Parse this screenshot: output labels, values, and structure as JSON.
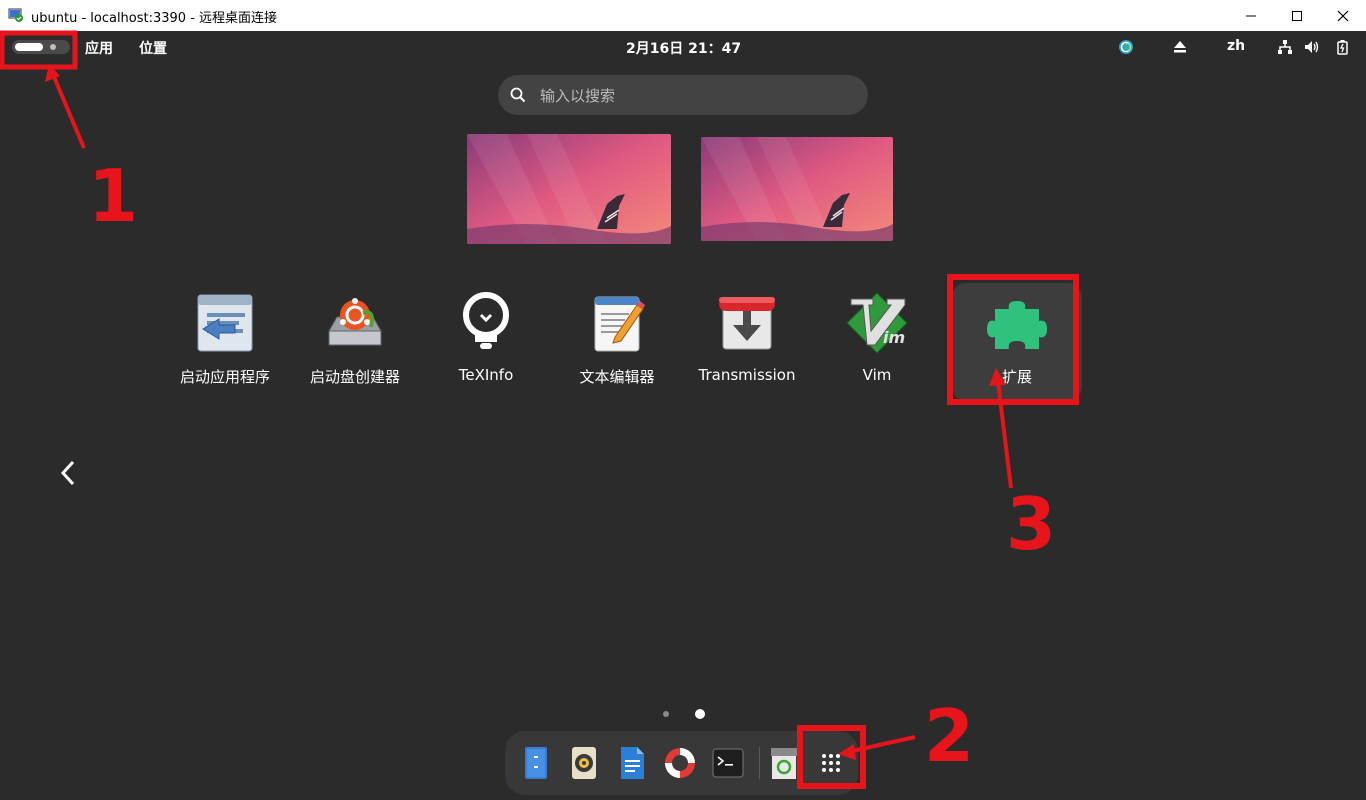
{
  "window": {
    "title": "ubuntu - localhost:3390 - 远程桌面连接",
    "controls": [
      "minimize-icon",
      "maximize-icon",
      "close-icon"
    ]
  },
  "topbar": {
    "apps_menu": "应用",
    "places_menu": "位置",
    "clock": "2月16日  21：47",
    "language": "zh",
    "tray_icons": [
      "update-icon",
      "eject-icon",
      "network-icon",
      "volume-icon",
      "battery-icon"
    ]
  },
  "search": {
    "placeholder": "输入以搜索"
  },
  "workspaces": [
    "workspace-1",
    "workspace-2"
  ],
  "apps": [
    {
      "label": "启动应用程序",
      "icon": "startup-apps-icon"
    },
    {
      "label": "启动盘创建器",
      "icon": "usb-creator-icon"
    },
    {
      "label": "TeXInfo",
      "icon": "lightbulb-icon"
    },
    {
      "label": "文本编辑器",
      "icon": "text-editor-icon"
    },
    {
      "label": "Transmission",
      "icon": "transmission-icon"
    },
    {
      "label": "Vim",
      "icon": "vim-icon"
    },
    {
      "label": "扩展",
      "icon": "puzzle-icon"
    }
  ],
  "pagination": {
    "pages": 2,
    "current": 2
  },
  "dock": [
    "files-icon",
    "rhythmbox-icon",
    "writer-icon",
    "help-icon",
    "terminal-icon",
    "trash-icon",
    "show-apps-icon"
  ],
  "annotations": {
    "labels": [
      "1",
      "2",
      "3"
    ],
    "color": "#e8141c"
  },
  "colors": {
    "background": "#2b2b2b",
    "accent_green": "#2ec27e",
    "annotation_red": "#e8141c"
  }
}
